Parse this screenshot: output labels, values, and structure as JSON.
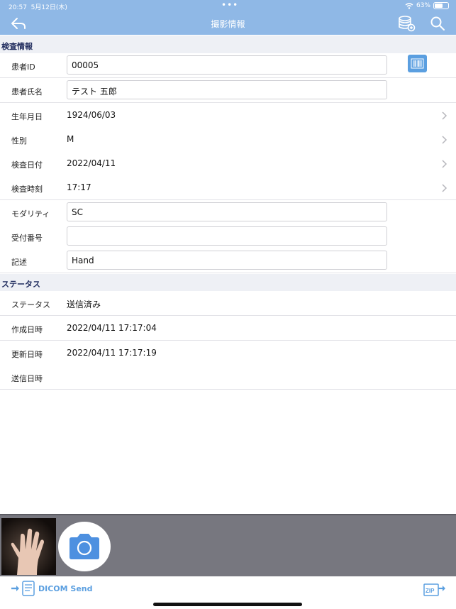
{
  "status_bar": {
    "time": "20:57",
    "date": "5月12日(木)",
    "battery": "63%",
    "battery_level": 0.63
  },
  "nav": {
    "title": "撮影情報",
    "icons": [
      "back-icon",
      "database-icon",
      "search-icon"
    ]
  },
  "sections": {
    "exam_info": "検査情報",
    "status": "ステータス"
  },
  "fields": {
    "patient_id": {
      "label": "患者ID",
      "value": "00005"
    },
    "patient_name": {
      "label": "患者氏名",
      "value": "テスト 五郎"
    },
    "birth_date": {
      "label": "生年月日",
      "value": "1924/06/03"
    },
    "sex": {
      "label": "性別",
      "value": "M"
    },
    "exam_date": {
      "label": "検査日付",
      "value": "2022/04/11"
    },
    "exam_time": {
      "label": "検査時刻",
      "value": "17:17"
    },
    "modality": {
      "label": "モダリティ",
      "value": "SC"
    },
    "accession_number": {
      "label": "受付番号",
      "value": ""
    },
    "description": {
      "label": "記述",
      "value": "Hand"
    }
  },
  "status_fields": {
    "status": {
      "label": "ステータス",
      "value": "送信済み"
    },
    "created": {
      "label": "作成日時",
      "value": "2022/04/11 17:17:04"
    },
    "updated": {
      "label": "更新日時",
      "value": "2022/04/11 17:17:19"
    },
    "sent": {
      "label": "送信日時",
      "value": ""
    }
  },
  "toolbar": {
    "dicom_send_label": "DICOM Send",
    "zip_label": "ZIP"
  },
  "colors": {
    "header": "#8fb8e6",
    "accent": "#5b9fe0",
    "section_bg": "#eef0f5",
    "section_text": "#1e2a5c",
    "gallery": "#77777f"
  }
}
